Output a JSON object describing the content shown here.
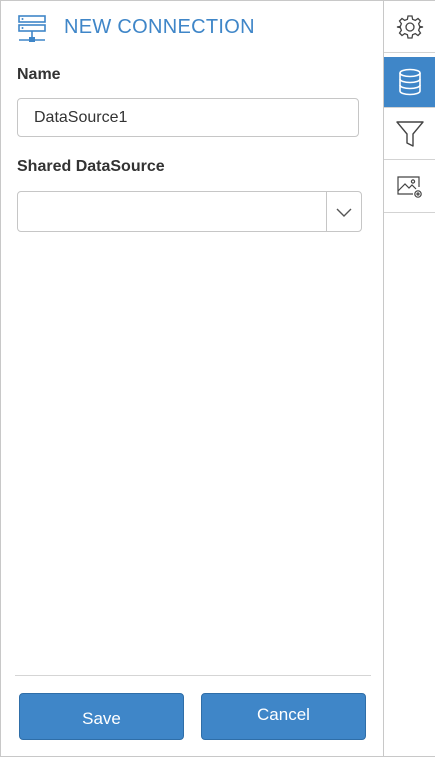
{
  "header": {
    "title": "NEW CONNECTION",
    "icon": "server-connection-icon",
    "accent_color": "#3f86c8"
  },
  "form": {
    "name_label": "Name",
    "name_value": "DataSource1",
    "shared_label": "Shared DataSource",
    "shared_value": ""
  },
  "footer": {
    "save_label": "Save",
    "cancel_label": "Cancel"
  },
  "rail": {
    "items": [
      {
        "icon": "gear-icon",
        "active": false
      },
      {
        "icon": "database-icon",
        "active": true
      },
      {
        "icon": "filter-icon",
        "active": false
      },
      {
        "icon": "image-settings-icon",
        "active": false
      }
    ]
  }
}
